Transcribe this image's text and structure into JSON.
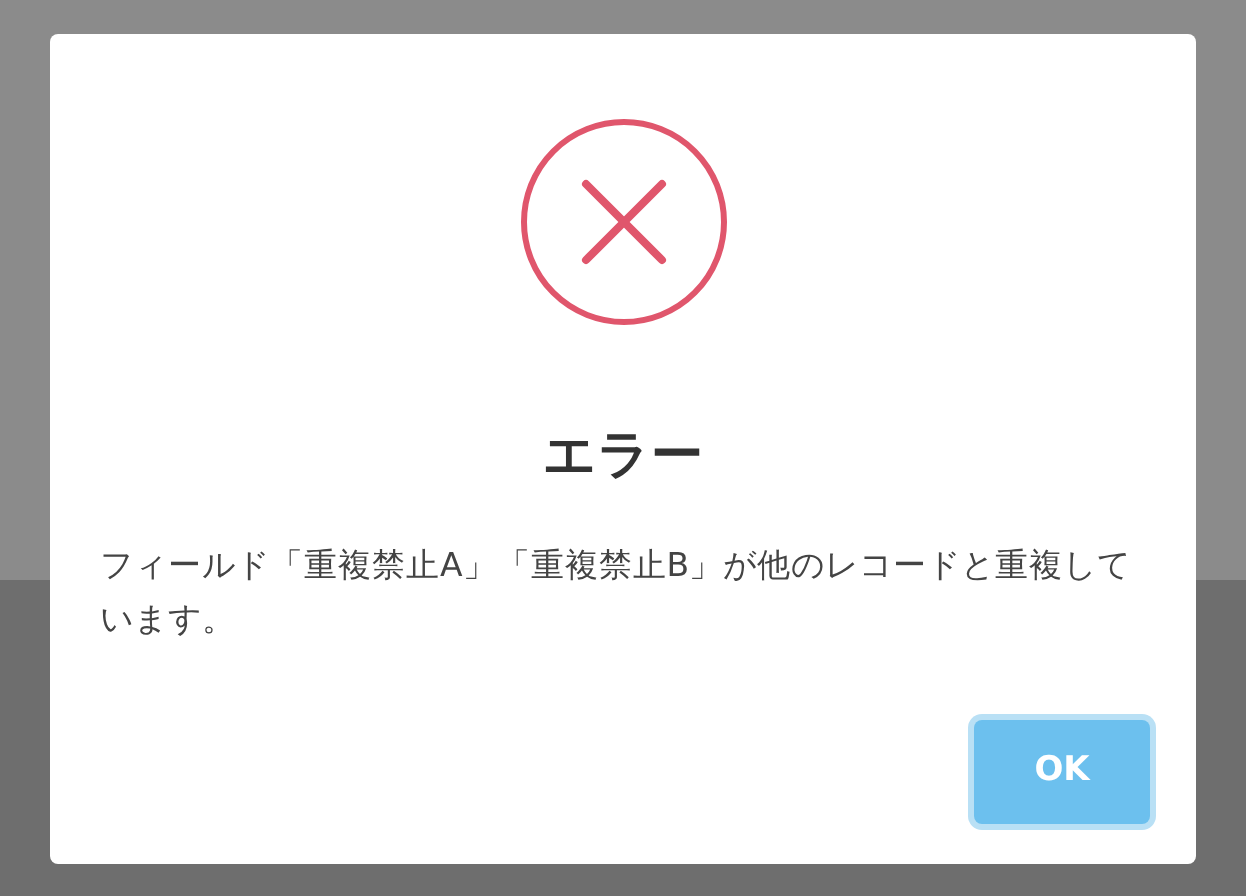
{
  "dialog": {
    "title": "エラー",
    "message": "フィールド「重複禁止A」「重複禁止B」が他のレコードと重複しています。",
    "buttons": [
      {
        "label": "OK",
        "focused": true
      }
    ]
  }
}
